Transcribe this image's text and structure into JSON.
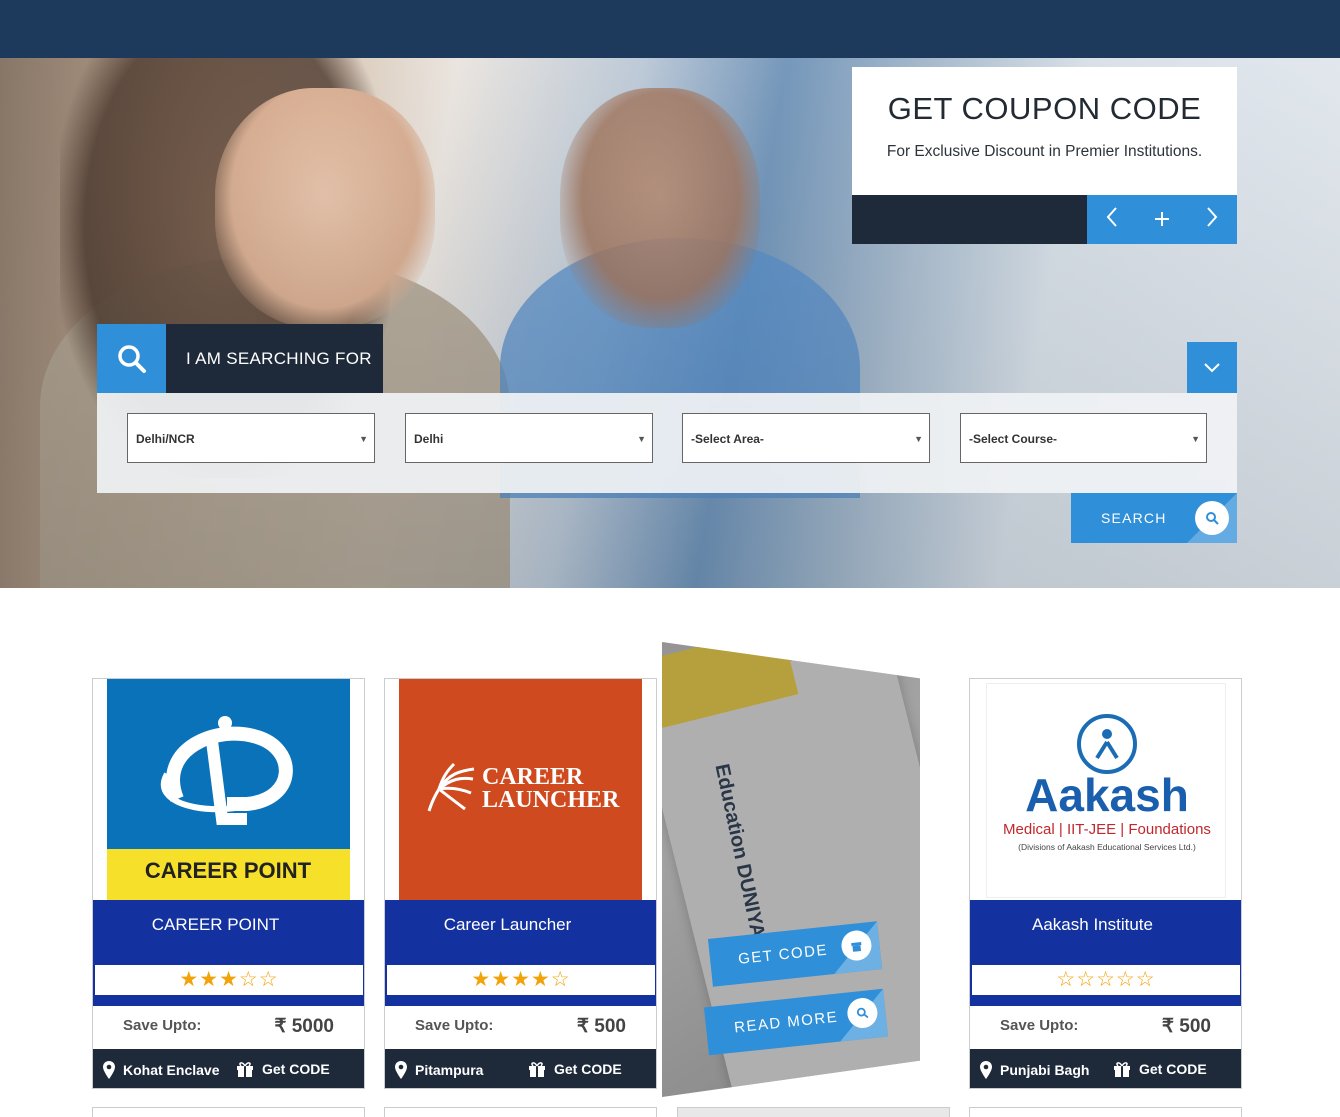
{
  "hero": {
    "coupon_title": "GET COUPON CODE",
    "coupon_subtitle": "For Exclusive Discount in Premier Institutions.",
    "prev_label": "‹",
    "add_label": "+",
    "next_label": "›"
  },
  "search": {
    "tab_label": "I AM SEARCHING FOR",
    "region": "Delhi/NCR",
    "city": "Delhi",
    "area": "-Select Area-",
    "course": "-Select Course-",
    "button_label": "SEARCH"
  },
  "cards": [
    {
      "name": "CAREER POINT",
      "rating": 3,
      "stars": "★★★☆☆",
      "save_label": "Save Upto:",
      "save_value": "₹ 5000",
      "location": "Kohat Enclave",
      "code_label": "Get CODE",
      "logo_text": "CAREER POINT"
    },
    {
      "name": "Career Launcher",
      "rating": 4,
      "stars": "★★★★☆",
      "save_label": "Save Upto:",
      "save_value": "₹ 500",
      "location": "Pitampura",
      "code_label": "Get CODE",
      "logo_line1": "CAREER",
      "logo_line2": "LAUNCHER"
    },
    {
      "name": "Aakash Institute",
      "rating": 0,
      "stars": "☆☆☆☆☆",
      "save_label": "Save Upto:",
      "save_value": "₹ 500",
      "location": "Punjabi Bagh",
      "code_label": "Get CODE",
      "logo_text": "Aakash",
      "logo_tag": "Medical | IIT-JEE | Foundations",
      "logo_note": "(Divisions of Aakash Educational Services Ltd.)"
    }
  ],
  "feature": {
    "brand_text": "Education DUNIYA",
    "get_code_label": "GET CODE",
    "read_more_label": "READ MORE"
  },
  "colors": {
    "accent": "#2f8fd8",
    "dark": "#1e2a3a",
    "band": "#1431a0",
    "star": "#f2a30a"
  }
}
